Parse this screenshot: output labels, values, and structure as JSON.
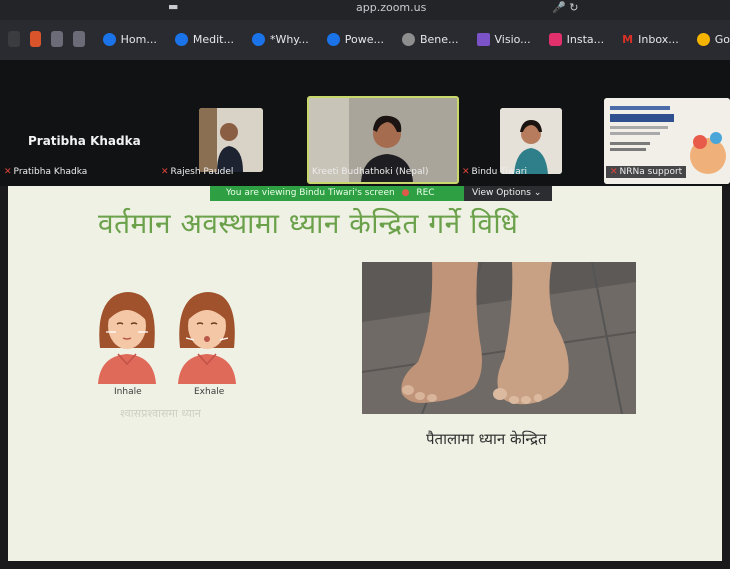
{
  "browser": {
    "url": "app.zoom.us",
    "url_icons": "🎤 ↻",
    "tabs": [
      {
        "label": "Hom...",
        "icon": "chrome-icon",
        "color": "#1a73e8"
      },
      {
        "label": "Medit...",
        "icon": "chrome-icon",
        "color": "#1a73e8"
      },
      {
        "label": "*Why...",
        "icon": "chrome-icon",
        "color": "#1a73e8"
      },
      {
        "label": "Powe...",
        "icon": "chrome-icon",
        "color": "#1a73e8"
      },
      {
        "label": "Bene...",
        "icon": "openai-icon",
        "color": "#8e8e8e"
      },
      {
        "label": "Visio...",
        "icon": "visio-icon",
        "color": "#7b52c7"
      },
      {
        "label": "Insta...",
        "icon": "instagram-icon",
        "color": "#e1306c"
      },
      {
        "label": "Inbox...",
        "icon": "gmail-icon",
        "color": "#d93025"
      },
      {
        "label": "Go",
        "icon": "google-icon",
        "color": "#f4b400"
      }
    ]
  },
  "zoom": {
    "host_name": "Pratibha Khadka",
    "participants": [
      {
        "name": "Pratibha Khadka",
        "muted": true
      },
      {
        "name": "Rajesh Paudel",
        "muted": true
      },
      {
        "name": "Kreeti Budhathoki (Nepal)",
        "muted": false
      },
      {
        "name": "Bindu Tiwari",
        "muted": true
      },
      {
        "name": "NRNa support",
        "muted": true
      }
    ],
    "viewing_text": "You are viewing  Bindu Tiwari's screen",
    "rec_label": "REC",
    "view_options": "View Options",
    "accent": "#2ea043"
  },
  "slide": {
    "title": "वर्तमान अवस्थामा ध्यान केन्द्रित गर्ने विधि",
    "inhale_label": "Inhale",
    "exhale_label": "Exhale",
    "ghost_text": "श्वासप्रश्वासमा ध्यान",
    "caption": "पैतालामा ध्यान केन्द्रित",
    "title_color": "#6aa14a"
  }
}
